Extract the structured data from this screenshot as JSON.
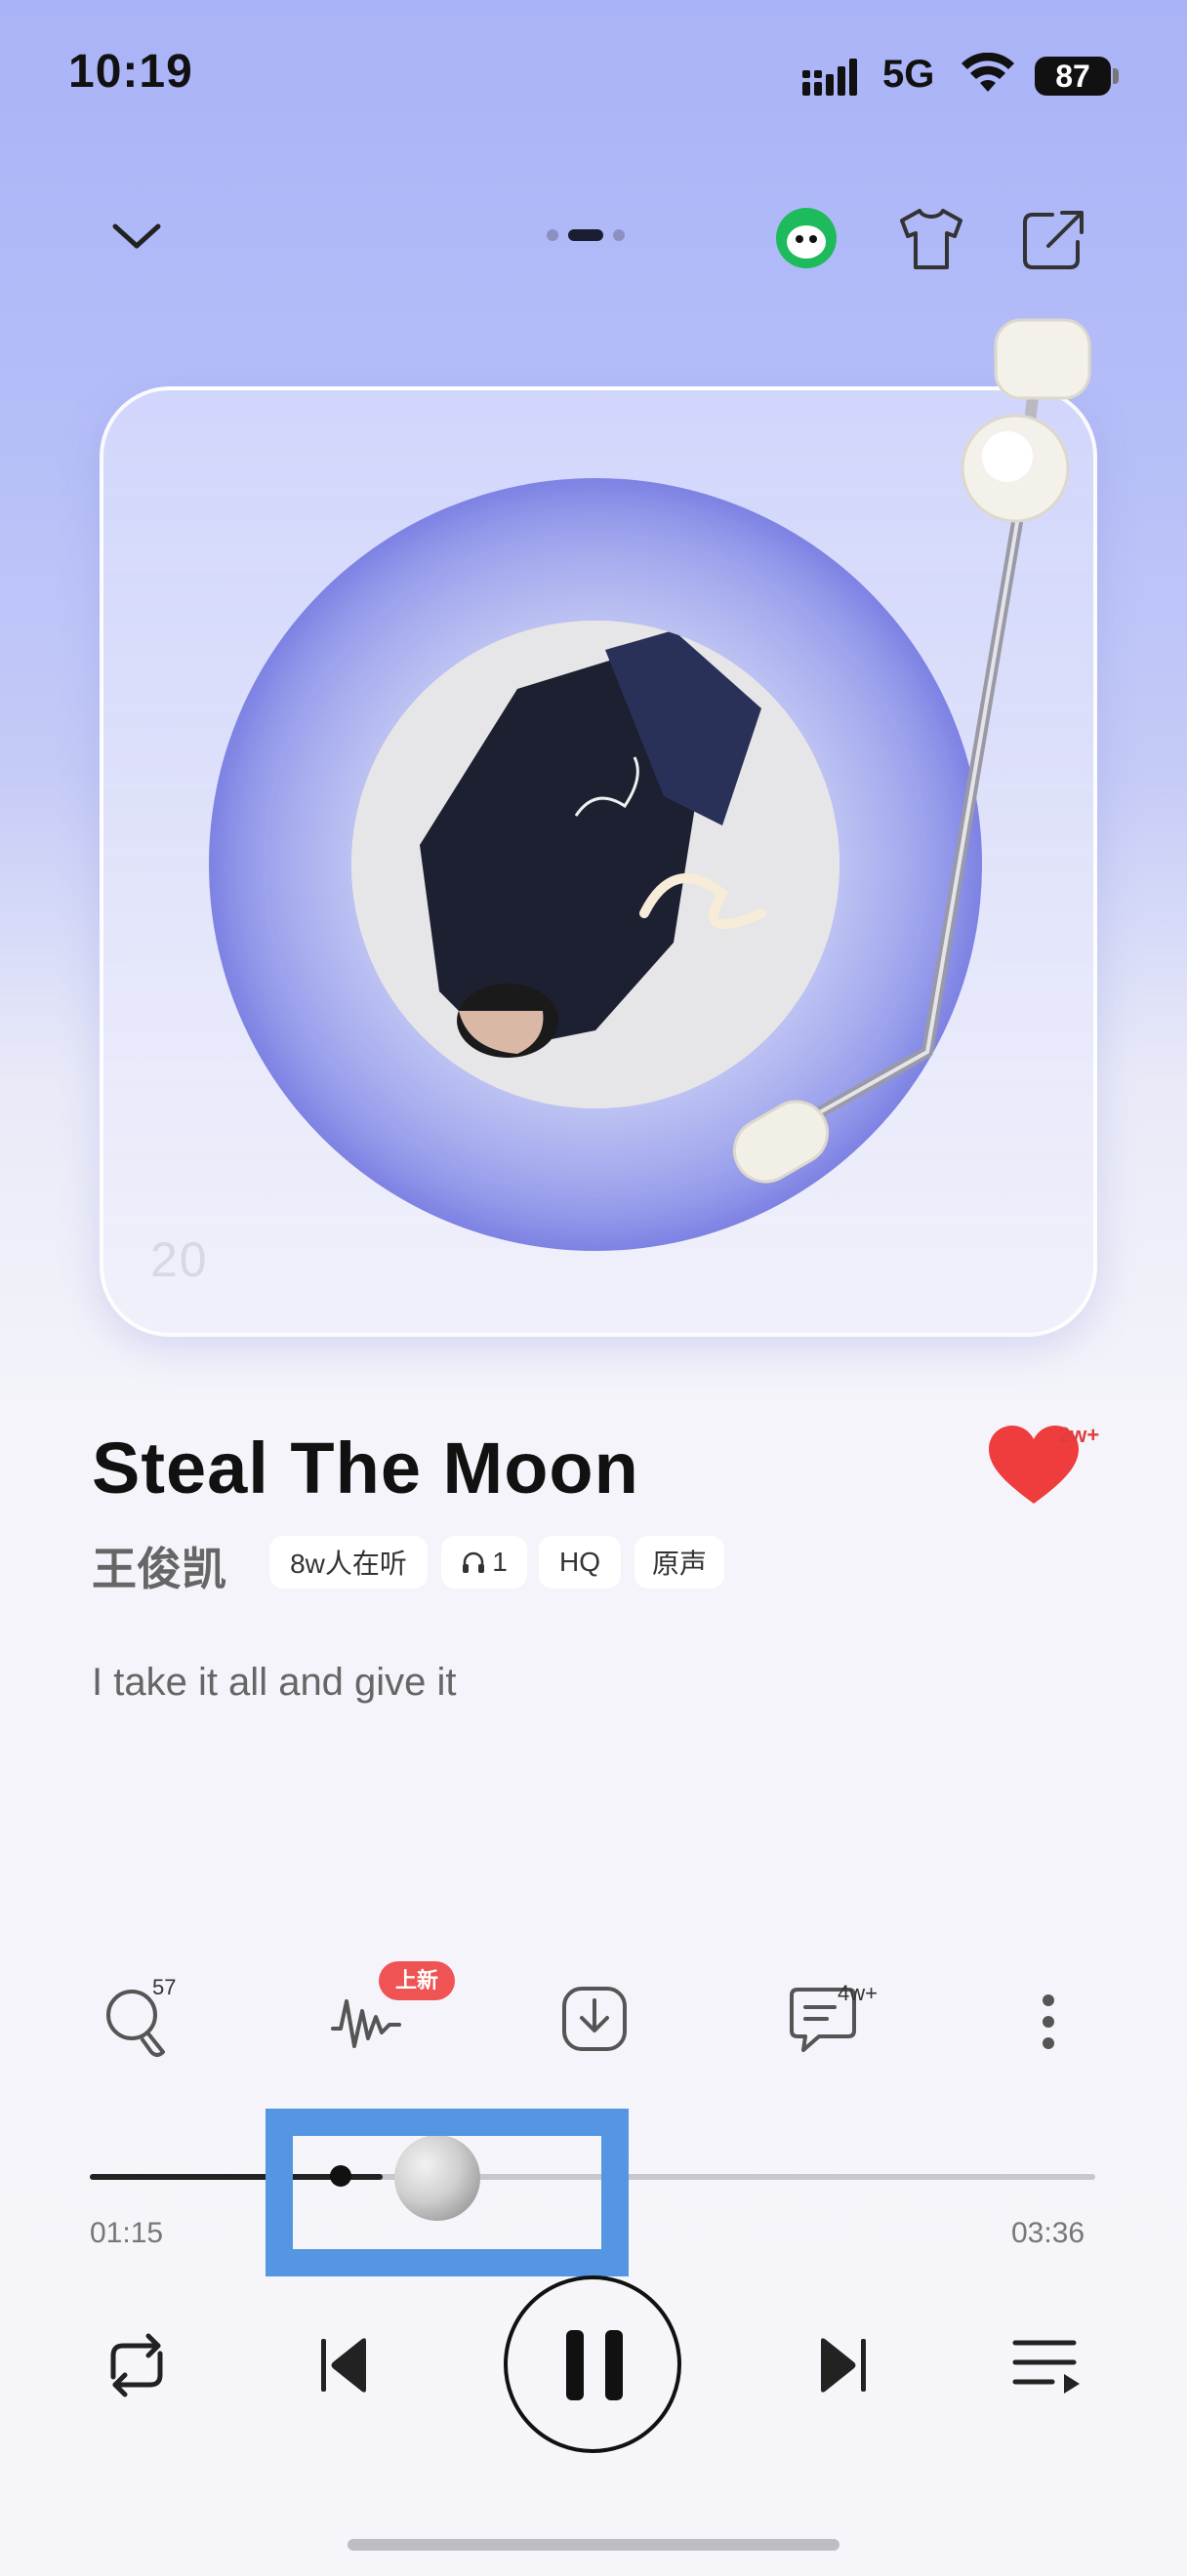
{
  "status_bar": {
    "time": "10:19",
    "network": "5G",
    "battery": "87"
  },
  "top_bar": {
    "collapse_icon": "chevron-down-icon",
    "page_indicator": {
      "count": 3,
      "active": 1
    },
    "mascot_icon": "mascot-icon",
    "skin_icon": "tshirt-icon",
    "share_icon": "share-icon"
  },
  "player_card": {
    "logo_text": "20"
  },
  "song": {
    "title": "Steal The Moon",
    "artist": "王俊凯",
    "tags": [
      "8w人在听",
      "1",
      "HQ",
      "原声"
    ],
    "like_count": "2w+",
    "lyric": "I take it all and give it"
  },
  "actions": {
    "search_count": "57",
    "sound_effect_badge": "上新",
    "comment_count": "4w+"
  },
  "progress": {
    "current": "01:15",
    "total": "03:36",
    "fraction": 0.347
  },
  "colors": {
    "accent_red": "#f05353",
    "highlight_box": "#5596e3",
    "disc_blue": "#6f72e3"
  }
}
